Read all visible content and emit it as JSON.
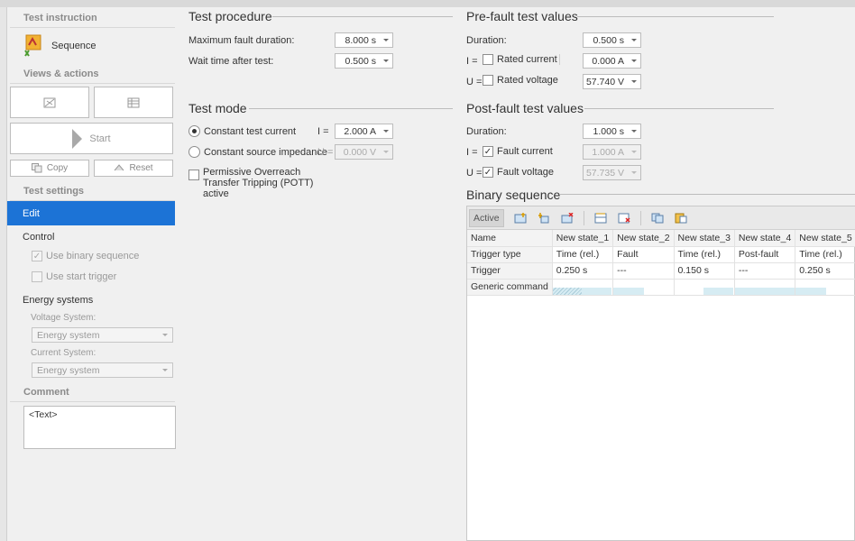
{
  "left": {
    "test_instruction": "Test instruction",
    "sequence_label": "Sequence",
    "views_actions": "Views & actions",
    "start_label": "Start",
    "copy_label": "Copy",
    "reset_label": "Reset",
    "test_settings": "Test settings",
    "edit_label": "Edit",
    "control_label": "Control",
    "use_binary_sequence": "Use binary sequence",
    "use_start_trigger": "Use start trigger",
    "energy_systems": "Energy systems",
    "voltage_system": "Voltage System:",
    "voltage_system_value": "Energy system",
    "current_system": "Current System:",
    "current_system_value": "Energy system",
    "comment": "Comment",
    "comment_text": "<Text>"
  },
  "test_procedure": {
    "title": "Test procedure",
    "max_fault_label": "Maximum fault duration:",
    "max_fault_value": "8.000 s",
    "wait_label": "Wait time after test:",
    "wait_value": "0.500 s"
  },
  "test_mode": {
    "title": "Test mode",
    "constant_current": "Constant test current",
    "i_label": "I =",
    "i_value": "2.000 A",
    "constant_impedance": "Constant source impedance",
    "u_label": "U =",
    "u_value": "0.000 V",
    "pott": "Permissive Overreach Transfer Tripping (POTT) active"
  },
  "prefault": {
    "title": "Pre-fault test values",
    "duration_label": "Duration:",
    "duration_value": "0.500 s",
    "i_label": "I =",
    "rated_current": "Rated current",
    "current_value": "0.000 A",
    "u_label": "U =",
    "rated_voltage": "Rated voltage",
    "voltage_value": "57.740 V"
  },
  "postfault": {
    "title": "Post-fault test values",
    "duration_label": "Duration:",
    "duration_value": "1.000 s",
    "i_label": "I =",
    "fault_current": "Fault current",
    "current_value": "1.000 A",
    "u_label": "U =",
    "fault_voltage": "Fault voltage",
    "voltage_value": "57.735 V"
  },
  "binary": {
    "title": "Binary sequence",
    "active_label": "Active",
    "headers": [
      "Name",
      "New state_1",
      "New state_2",
      "New state_3",
      "New state_4",
      "New state_5"
    ],
    "row_trigger_type": [
      "Trigger type",
      "Time (rel.)",
      "Fault",
      "Time (rel.)",
      "Post-fault",
      "Time (rel.)"
    ],
    "row_trigger": [
      "Trigger",
      "0.250 s",
      "---",
      "0.150 s",
      "---",
      "0.250 s"
    ],
    "row_generic": "Generic command"
  },
  "colors": {
    "accent": "#1c73d6",
    "bar": "#d6ecf3"
  }
}
